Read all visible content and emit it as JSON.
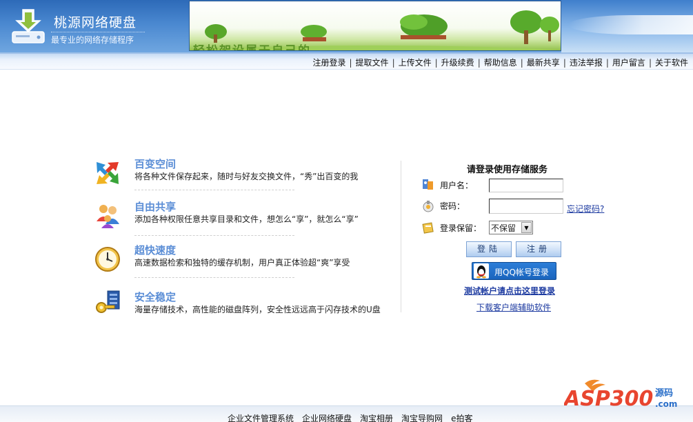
{
  "header": {
    "app_title": "桃源网络硬盘",
    "app_subtitle": "最专业的网络存储程序",
    "banner_text": "轻松架设属于自己的"
  },
  "nav": {
    "items": [
      {
        "label": "注册登录"
      },
      {
        "label": "提取文件"
      },
      {
        "label": "上传文件"
      },
      {
        "label": "升级续费"
      },
      {
        "label": "帮助信息"
      },
      {
        "label": "最新共享"
      },
      {
        "label": "违法举报"
      },
      {
        "label": "用户留言"
      },
      {
        "label": "关于软件"
      }
    ]
  },
  "features": [
    {
      "title": "百变空间",
      "desc": "将各种文件保存起来，随时与好友交换文件，“秀”出百变的我",
      "icon": "arrows-icon"
    },
    {
      "title": "自由共享",
      "desc": "添加各种权限任意共享目录和文件，想怎么“享”，就怎么“享”",
      "icon": "users-icon"
    },
    {
      "title": "超快速度",
      "desc": "高速数据检索和独特的缓存机制，用户真正体验超“爽”享受",
      "icon": "clock-icon"
    },
    {
      "title": "安全稳定",
      "desc": "海量存储技术，高性能的磁盘阵列，安全性远远高于闪存技术的U盘",
      "icon": "key-icon"
    }
  ],
  "login": {
    "title": "请登录使用存储服务",
    "username_label": "用户名：",
    "username_value": "",
    "password_label": "密码：",
    "password_value": "",
    "forgot_label": "忘记密码?",
    "remember_label": "登录保留：",
    "remember_value": "不保留",
    "login_button": "登陆",
    "register_button": "注册",
    "qq_button": "用QQ帐号登录",
    "test_account_link": "测试帐户请点击这里登录",
    "download_client_link": "下载客户端辅助软件"
  },
  "footer": {
    "links": [
      "企业文件管理系统",
      "企业网络硬盘",
      "淘宝相册",
      "淘宝导购网",
      "e拍客"
    ],
    "watermark": "ASP300源码 .com"
  },
  "colors": {
    "header_blue": "#2d6ab8",
    "feature_title": "#5b8ed6",
    "link_blue": "#1c3aa0"
  }
}
